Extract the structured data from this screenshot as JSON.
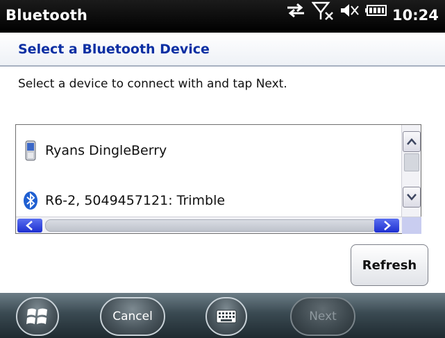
{
  "statusbar": {
    "app_title": "Bluetooth",
    "time": "10:24",
    "icons": [
      "sync-arrows-icon",
      "no-signal-icon",
      "volume-muted-icon",
      "battery-icon"
    ]
  },
  "header": {
    "title": "Select a Bluetooth Device"
  },
  "instruction": "Select a device to connect with and tap Next.",
  "devices": [
    {
      "name": "Ryans DingleBerry",
      "icon": "phone-icon"
    },
    {
      "name": "R6-2, 5049457121: Trimble",
      "icon": "bluetooth-icon"
    }
  ],
  "buttons": {
    "refresh": "Refresh",
    "cancel": "Cancel",
    "next": "Next"
  },
  "colors": {
    "header_title": "#0b2fa3",
    "scroll_arrow": "#1d2fd0",
    "statusbar": "#000000"
  }
}
